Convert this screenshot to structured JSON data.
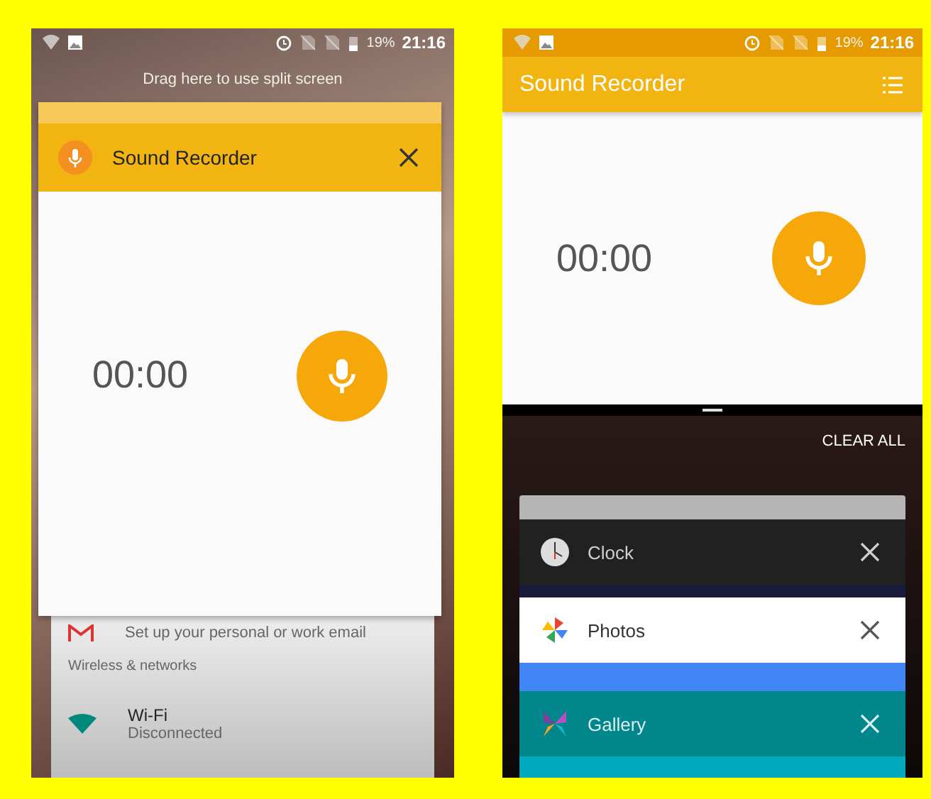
{
  "left_screen": {
    "status_bar": {
      "battery": "19%",
      "time": "21:16"
    },
    "split_hint": "Drag here to use split screen",
    "app_card": {
      "title": "Sound Recorder",
      "timer": "00:00"
    },
    "settings": {
      "email_subtitle": "Set up your personal or work email",
      "section": "Wireless & networks",
      "wifi_title": "Wi-Fi",
      "wifi_subtitle": "Disconnected"
    }
  },
  "right_screen": {
    "status_bar": {
      "battery": "19%",
      "time": "21:16"
    },
    "app_bar": {
      "title": "Sound Recorder"
    },
    "timer": "00:00",
    "recents": {
      "clear_all": "CLEAR ALL",
      "cards": [
        {
          "kind": "clock",
          "label": "Clock"
        },
        {
          "kind": "photos",
          "label": "Photos"
        },
        {
          "kind": "gallery",
          "label": "Gallery"
        }
      ]
    }
  }
}
